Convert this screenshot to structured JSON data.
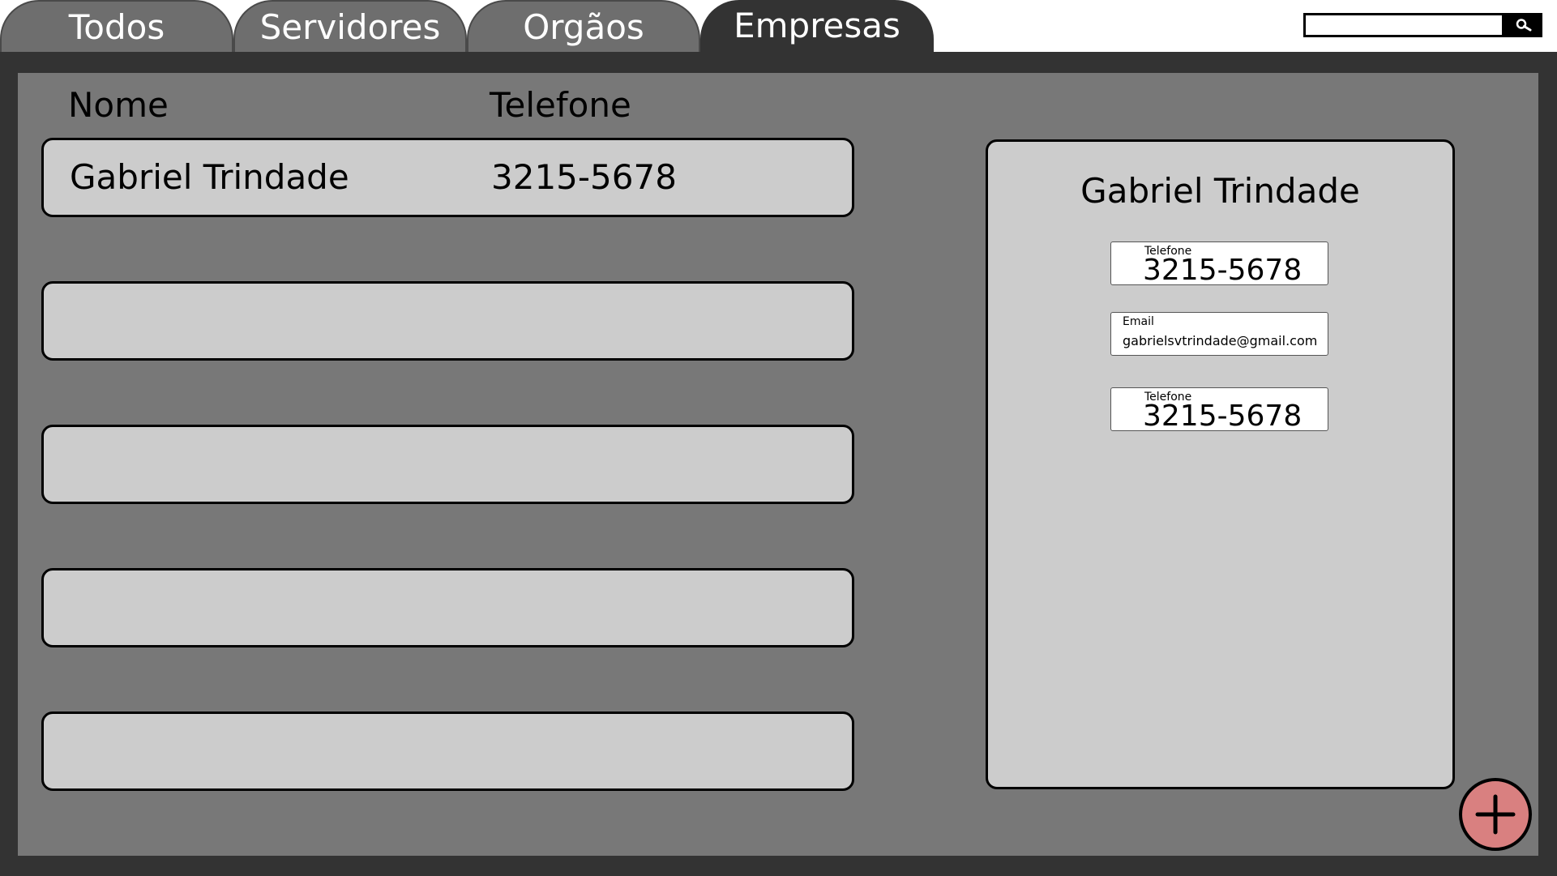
{
  "tabs": [
    {
      "label": "Todos",
      "active": false
    },
    {
      "label": "Servidores",
      "active": false
    },
    {
      "label": "Orgãos",
      "active": false
    },
    {
      "label": "Empresas",
      "active": true
    }
  ],
  "search": {
    "value": "",
    "icon": "search-icon"
  },
  "list": {
    "headers": {
      "name": "Nome",
      "phone": "Telefone"
    },
    "rows": [
      {
        "name": "Gabriel Trindade",
        "phone": "3215-5678"
      },
      {
        "name": "",
        "phone": ""
      },
      {
        "name": "",
        "phone": ""
      },
      {
        "name": "",
        "phone": ""
      },
      {
        "name": "",
        "phone": ""
      }
    ]
  },
  "detail": {
    "name": "Gabriel Trindade",
    "fields": [
      {
        "label": "Telefone",
        "value": "3215-5678"
      },
      {
        "label": "Email",
        "value": "gabrielsvtrindade@gmail.com"
      },
      {
        "label": "Telefone",
        "value": "3215-5678"
      }
    ]
  },
  "add_button": {
    "icon": "plus-icon",
    "color": "#d98080"
  },
  "colors": {
    "frame": "#333333",
    "panel": "#787878",
    "card": "#cccccc",
    "tab_inactive": "#6e6e6e"
  }
}
